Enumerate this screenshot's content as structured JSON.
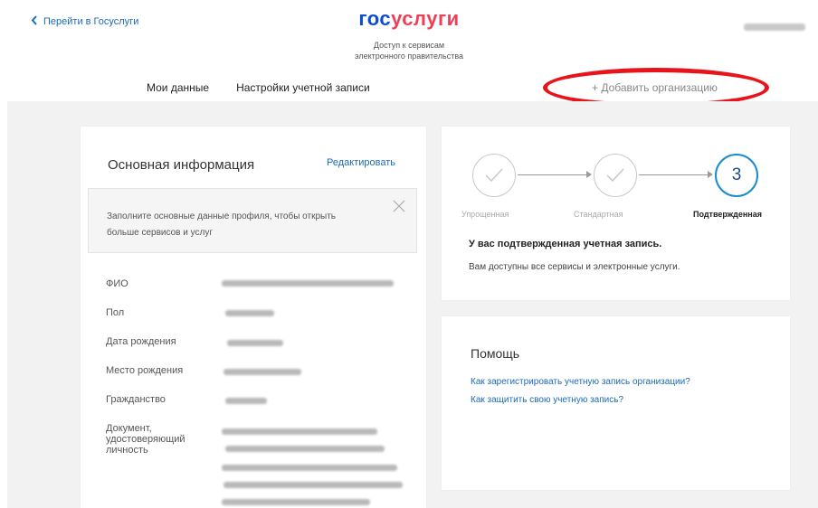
{
  "header": {
    "back_link": "Перейти в Госуслуги",
    "logo_part1": "гос",
    "logo_part2": "услуги",
    "subtitle_line1": "Доступ к сервисам",
    "subtitle_line2": "электронного правительства"
  },
  "tabs": [
    {
      "label": "Мои данные",
      "active": true
    },
    {
      "label": "Настройки учетной записи",
      "active": false
    }
  ],
  "add_org_label": "+ Добавить организацию",
  "main_info": {
    "title": "Основная информация",
    "edit_label": "Редактировать",
    "notice": "Заполните основные данные профиля, чтобы открыть больше сервисов и услуг",
    "fields": [
      {
        "label": "ФИО"
      },
      {
        "label": "Пол"
      },
      {
        "label": "Дата рождения"
      },
      {
        "label": "Место рождения"
      },
      {
        "label": "Гражданство"
      },
      {
        "label": "Документ, удостоверяющий личность"
      }
    ]
  },
  "account_status": {
    "steps": [
      {
        "label": "Упрощенная",
        "state": "done"
      },
      {
        "label": "Стандартная",
        "state": "done"
      },
      {
        "label": "Подтвержденная",
        "state": "current",
        "number": "3"
      }
    ],
    "title": "У вас подтвержденная учетная запись.",
    "description": "Вам доступны все сервисы и электронные услуги."
  },
  "help": {
    "title": "Помощь",
    "links": [
      "Как зарегистрировать учетную запись организации?",
      "Как защитить свою учетную запись?"
    ]
  },
  "colors": {
    "accent": "#0d4cd3",
    "brand_red": "#ee3f58",
    "link": "#1a6ab8",
    "highlight_ellipse": "#e8141b",
    "background": "#f2f2f2"
  }
}
